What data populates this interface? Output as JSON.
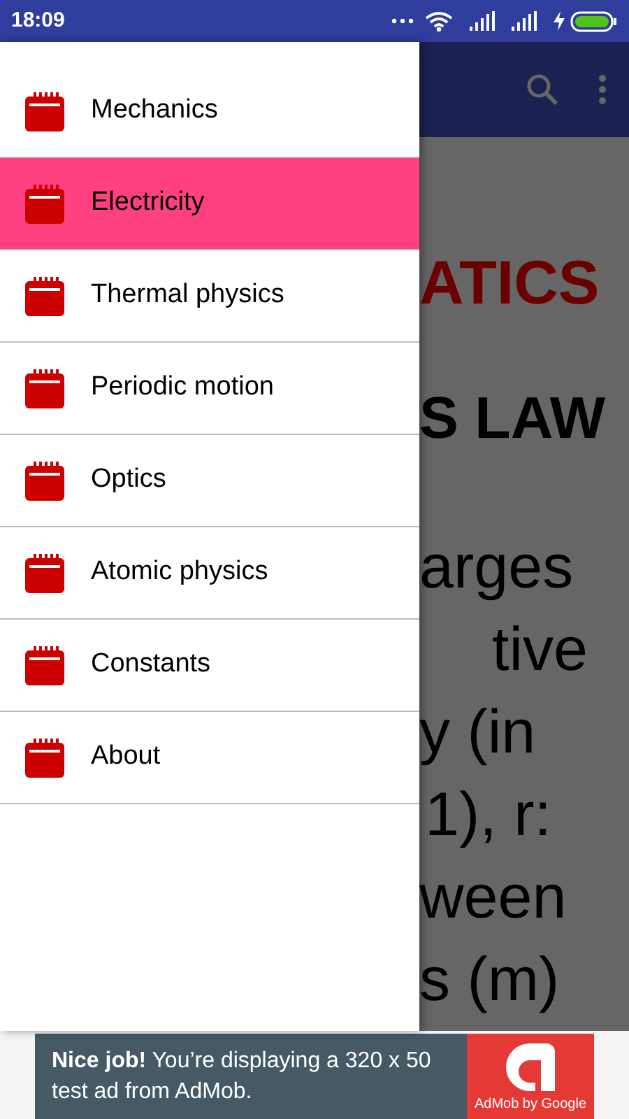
{
  "status_bar": {
    "time": "18:09"
  },
  "drawer": {
    "items": [
      {
        "label": "Mechanics",
        "selected": false
      },
      {
        "label": "Electricity",
        "selected": true
      },
      {
        "label": "Thermal physics",
        "selected": false
      },
      {
        "label": "Periodic motion",
        "selected": false
      },
      {
        "label": "Optics",
        "selected": false
      },
      {
        "label": "Atomic physics",
        "selected": false
      },
      {
        "label": "Constants",
        "selected": false
      },
      {
        "label": "About",
        "selected": false
      }
    ]
  },
  "content": {
    "heading": "ATICS",
    "subheading": "S LAW",
    "body_lines": [
      "arges",
      "tive",
      "y (in",
      "1), r:",
      "ween",
      "s (m)"
    ]
  },
  "ad": {
    "text": "**Nice job!** You’re displaying a 320 x 50 test ad from AdMob.",
    "brand": "AdMob by Google"
  }
}
